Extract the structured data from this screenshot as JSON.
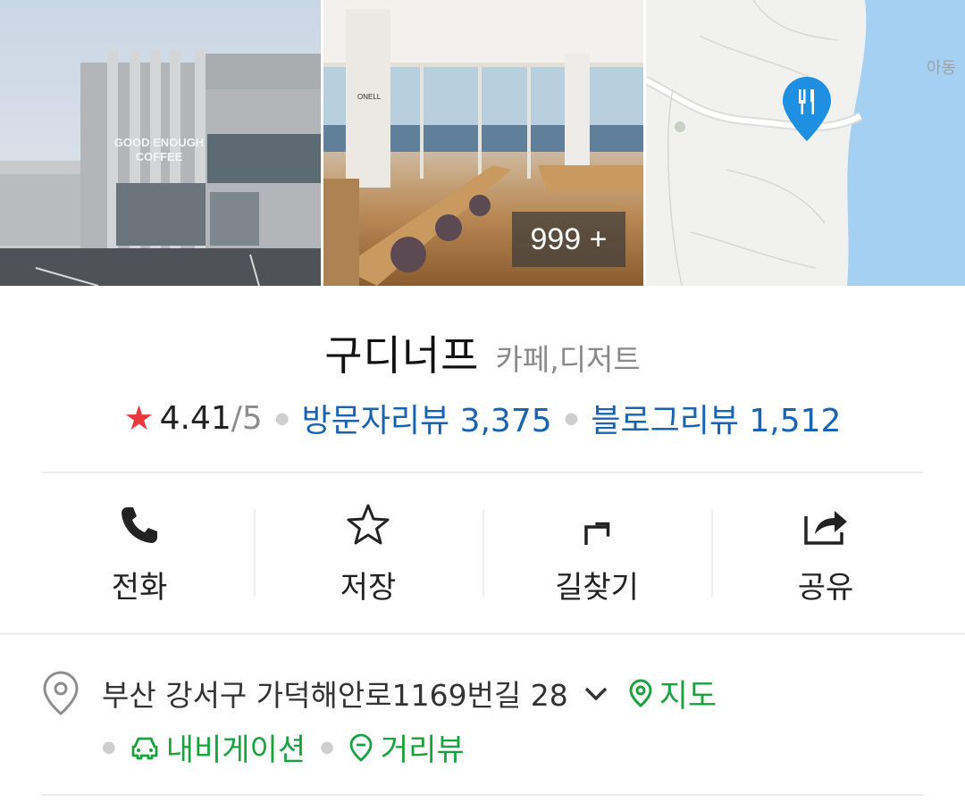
{
  "photos": {
    "building_sign": "GOOD ENOUGH COFFEE",
    "cafe_interior_sign": "ONELL",
    "more_count_label": "999 +",
    "map_place_label": "아동"
  },
  "place": {
    "name": "구디너프",
    "category": "카페,디저트"
  },
  "rating": {
    "score": "4.41",
    "max": "/5",
    "visitor_reviews_label": "방문자리뷰 3,375",
    "blog_reviews_label": "블로그리뷰 1,512",
    "star_color": "#e9383f",
    "link_color": "#1a63b0"
  },
  "actions": [
    {
      "icon": "phone-icon",
      "label": "전화"
    },
    {
      "icon": "star-outline-icon",
      "label": "저장"
    },
    {
      "icon": "directions-icon",
      "label": "길찾기"
    },
    {
      "icon": "share-icon",
      "label": "공유"
    }
  ],
  "address": {
    "text": "부산 강서구 가덕해안로1169번길 28",
    "map_link": "지도",
    "navigation_link": "내비게이션",
    "streetview_link": "거리뷰",
    "link_color": "#1aa23e"
  }
}
